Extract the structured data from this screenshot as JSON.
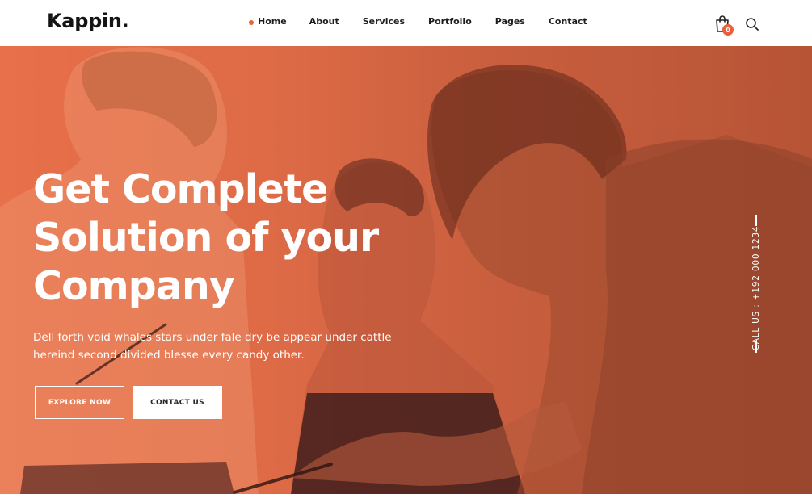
{
  "brand": {
    "logo": "Kappin."
  },
  "nav": {
    "items": [
      {
        "label": "Home",
        "active": true
      },
      {
        "label": "About"
      },
      {
        "label": "Services"
      },
      {
        "label": "Portfolio"
      },
      {
        "label": "Pages"
      },
      {
        "label": "Contact"
      }
    ]
  },
  "header_actions": {
    "cart_count": "0",
    "cart_icon": "shopping-bag-icon",
    "search_icon": "search-icon"
  },
  "hero": {
    "title_lines": [
      "Get Complete",
      "Solution of your",
      "Company"
    ],
    "description_line1": "Dell forth void whales stars under fale dry be appear under cattle",
    "description_line2": "hereind second divided blesse every candy other.",
    "explore_button": "EXPLORE NOW",
    "contact_button": "CONTACT US",
    "call_text": "CALL US : +192 000 1234"
  },
  "colors": {
    "accent": "#e8603c",
    "hero_overlay": "#d9653f",
    "white": "#ffffff",
    "text_dark": "#1c1c1c"
  }
}
